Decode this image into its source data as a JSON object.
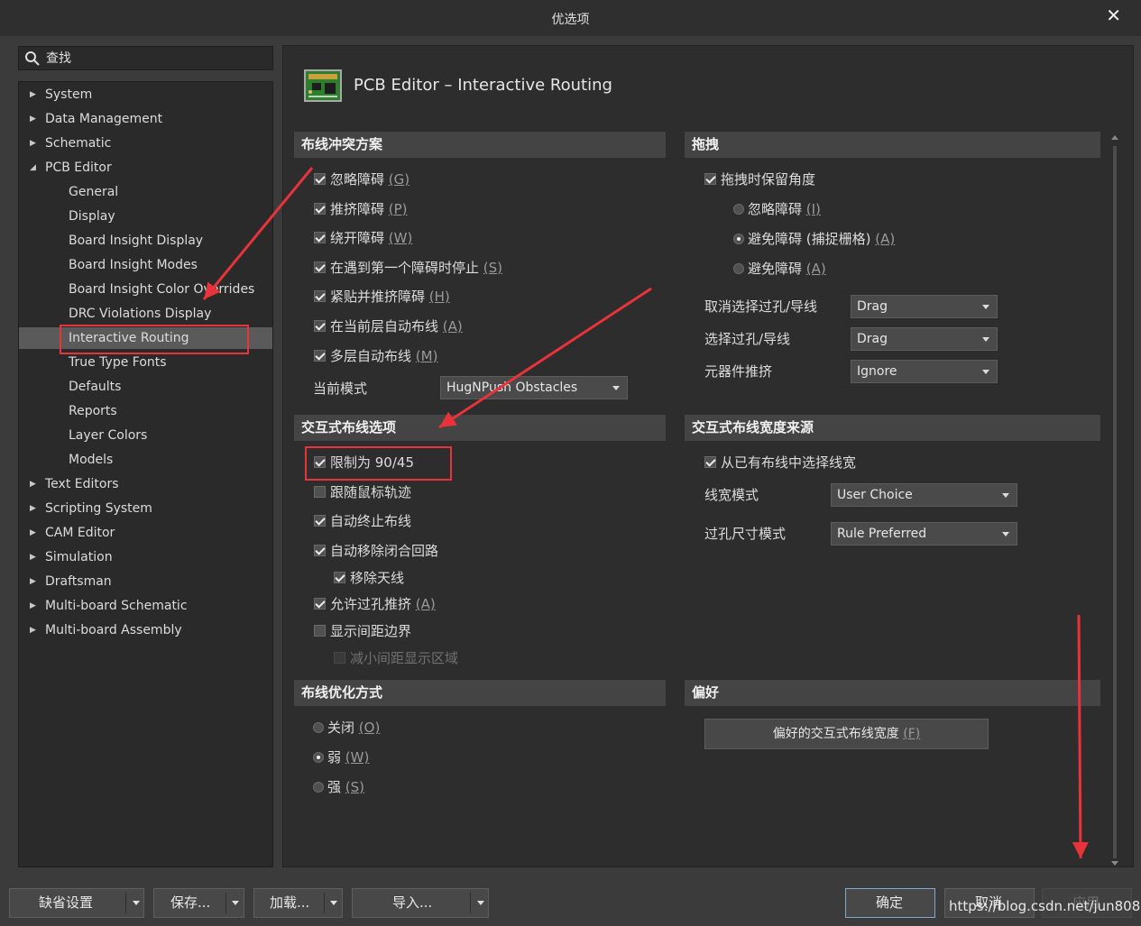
{
  "window": {
    "title": "优选项"
  },
  "search": {
    "placeholder": "查找"
  },
  "tree": [
    {
      "label": "System",
      "level": 0,
      "arrow": "▶"
    },
    {
      "label": "Data Management",
      "level": 0,
      "arrow": "▶"
    },
    {
      "label": "Schematic",
      "level": 0,
      "arrow": "▶"
    },
    {
      "label": "PCB Editor",
      "level": 0,
      "arrow": "◢"
    },
    {
      "label": "General",
      "level": 1
    },
    {
      "label": "Display",
      "level": 1
    },
    {
      "label": "Board Insight Display",
      "level": 1
    },
    {
      "label": "Board Insight Modes",
      "level": 1
    },
    {
      "label": "Board Insight Color Overrides",
      "level": 1
    },
    {
      "label": "DRC Violations Display",
      "level": 1
    },
    {
      "label": "Interactive Routing",
      "level": 1,
      "selected": true
    },
    {
      "label": "True Type Fonts",
      "level": 1
    },
    {
      "label": "Defaults",
      "level": 1
    },
    {
      "label": "Reports",
      "level": 1
    },
    {
      "label": "Layer Colors",
      "level": 1
    },
    {
      "label": "Models",
      "level": 1
    },
    {
      "label": "Text Editors",
      "level": 0,
      "arrow": "▶"
    },
    {
      "label": "Scripting System",
      "level": 0,
      "arrow": "▶"
    },
    {
      "label": "CAM Editor",
      "level": 0,
      "arrow": "▶"
    },
    {
      "label": "Simulation",
      "level": 0,
      "arrow": "▶"
    },
    {
      "label": "Draftsman",
      "level": 0,
      "arrow": "▶"
    },
    {
      "label": "Multi-board Schematic",
      "level": 0,
      "arrow": "▶"
    },
    {
      "label": "Multi-board Assembly",
      "level": 0,
      "arrow": "▶"
    }
  ],
  "header": {
    "title": "PCB Editor – Interactive Routing",
    "icon": "pcb-board-icon"
  },
  "conflict": {
    "title": "布线冲突方案",
    "options": [
      {
        "text": "忽略障碍 ",
        "key": "(G)",
        "checked": true
      },
      {
        "text": "推挤障碍 ",
        "key": "(P)",
        "checked": true
      },
      {
        "text": "绕开障碍 ",
        "key": "(W)",
        "checked": true
      },
      {
        "text": "在遇到第一个障碍时停止 ",
        "key": "(S)",
        "checked": true
      },
      {
        "text": "紧贴并推挤障碍 ",
        "key": "(H)",
        "checked": true
      },
      {
        "text": "在当前层自动布线 ",
        "key": "(A)",
        "checked": true
      },
      {
        "text": "多层自动布线 ",
        "key": "(M)",
        "checked": true
      }
    ],
    "mode_label": "当前模式",
    "mode_value": "HugNPush Obstacles"
  },
  "drag": {
    "title": "拖拽",
    "keep_angle": {
      "text": "拖拽时保留角度",
      "checked": true
    },
    "radios": [
      {
        "text": "忽略障碍 ",
        "key": "(I)",
        "checked": false
      },
      {
        "text": "避免障碍 (捕捉栅格) ",
        "key": "(A)",
        "checked": true
      },
      {
        "text": "避免障碍 ",
        "key": "(A)",
        "checked": false
      }
    ],
    "selects": [
      {
        "label": "取消选择过孔/导线",
        "value": "Drag"
      },
      {
        "label": "选择过孔/导线",
        "value": "Drag"
      },
      {
        "label": "元器件推挤",
        "value": "Ignore"
      }
    ]
  },
  "interactive": {
    "title": "交互式布线选项",
    "options": [
      {
        "text": "限制为 90/45",
        "checked": true
      },
      {
        "text": "跟随鼠标轨迹",
        "checked": false
      },
      {
        "text": "自动终止布线",
        "checked": true
      },
      {
        "text": "自动移除闭合回路",
        "checked": true
      },
      {
        "text": "移除天线",
        "checked": true
      },
      {
        "text": "允许过孔推挤 ",
        "key": "(A)",
        "checked": true
      },
      {
        "text": "显示间距边界",
        "checked": false
      },
      {
        "text": "减小间距显示区域",
        "checked": false,
        "disabled": true
      }
    ]
  },
  "width_source": {
    "title": "交互式布线宽度来源",
    "pick_existing": {
      "text": "从已有布线中选择线宽",
      "checked": true
    },
    "selects": [
      {
        "label": "线宽模式",
        "value": "User Choice"
      },
      {
        "label": "过孔尺寸模式",
        "value": "Rule Preferred"
      }
    ]
  },
  "optimize": {
    "title": "布线优化方式",
    "radios": [
      {
        "text": "关闭 ",
        "key": "(O)",
        "checked": false
      },
      {
        "text": "弱 ",
        "key": "(W)",
        "checked": true
      },
      {
        "text": "强 ",
        "key": "(S)",
        "checked": false
      }
    ]
  },
  "favorites": {
    "title": "偏好",
    "button": "偏好的交互式布线宽度 ",
    "button_key": "(F)"
  },
  "footer": {
    "defaults": "缺省设置",
    "save": "保存...",
    "load": "加载...",
    "import": "导入...",
    "ok": "确定",
    "cancel": "取消",
    "apply": "应用"
  },
  "watermark": "https://blog.csdn.net/jun8086",
  "colors": {
    "annotation": "#e8333a",
    "selected": "#5a5a5a",
    "panel": "#2d2d2d"
  }
}
